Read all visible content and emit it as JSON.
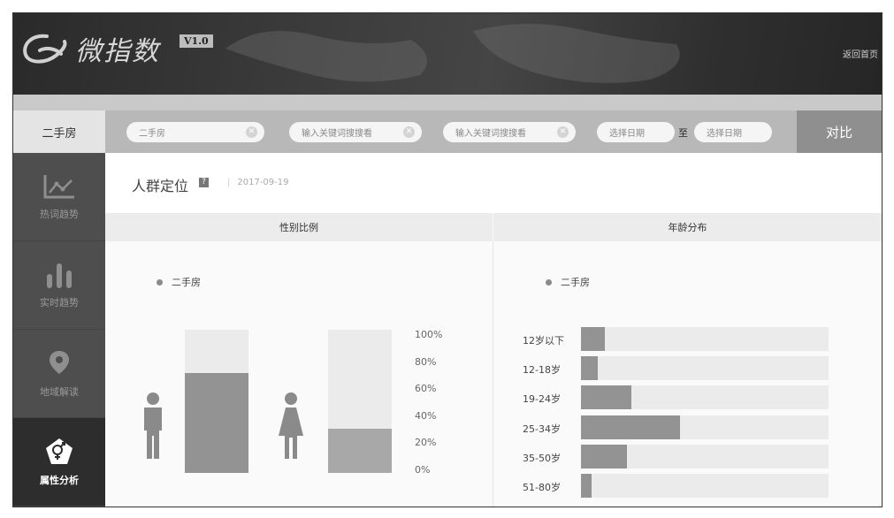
{
  "header": {
    "app_name": "微指数",
    "version": "V1.0",
    "home_link": "返回首页"
  },
  "toolbar": {
    "category": "二手房",
    "keyword1_value": "二手房",
    "keyword2_placeholder": "输入关键词搜搜看",
    "keyword3_placeholder": "输入关键词搜搜看",
    "date_start_placeholder": "选择日期",
    "to_label": "至",
    "date_end_placeholder": "选择日期",
    "compare_label": "对比"
  },
  "sidebar": {
    "items": [
      {
        "label": "热词趋势",
        "icon": "trend-line-icon"
      },
      {
        "label": "实时趋势",
        "icon": "bar-chart-icon"
      },
      {
        "label": "地域解读",
        "icon": "map-pin-icon"
      },
      {
        "label": "属性分析",
        "icon": "gender-icon"
      }
    ]
  },
  "section": {
    "title": "人群定位",
    "help": "?",
    "date": "2017-09-19"
  },
  "gender_panel": {
    "title": "性别比例",
    "legend": "二手房",
    "y_ticks": [
      "100%",
      "80%",
      "60%",
      "40%",
      "20%",
      "0%"
    ]
  },
  "age_panel": {
    "title": "年龄分布",
    "legend": "二手房",
    "labels": [
      "12岁以下",
      "12-18岁",
      "19-24岁",
      "25-34岁",
      "35-50岁",
      "51-80岁"
    ]
  },
  "chart_data": [
    {
      "type": "bar",
      "title": "性别比例",
      "categories": [
        "男",
        "女"
      ],
      "series": [
        {
          "name": "二手房",
          "values": [
            70,
            31
          ]
        }
      ],
      "ylim": [
        0,
        100
      ],
      "unit": "%"
    },
    {
      "type": "bar",
      "orientation": "horizontal",
      "title": "年龄分布",
      "categories": [
        "12岁以下",
        "12-18岁",
        "19-24岁",
        "25-34岁",
        "35-50岁",
        "51-80岁"
      ],
      "series": [
        {
          "name": "二手房",
          "values": [
            9.6,
            6.8,
            20.4,
            40,
            18.6,
            4.3
          ]
        }
      ],
      "xlim": [
        0,
        100
      ],
      "unit": "%"
    }
  ],
  "colors": {
    "bar_fill": "#939393",
    "bar_track": "#ebebeb",
    "female_fill": "#a8a8a8",
    "sidebar_bg": "#4e4e4e",
    "active_bg": "#2d2d2d"
  }
}
